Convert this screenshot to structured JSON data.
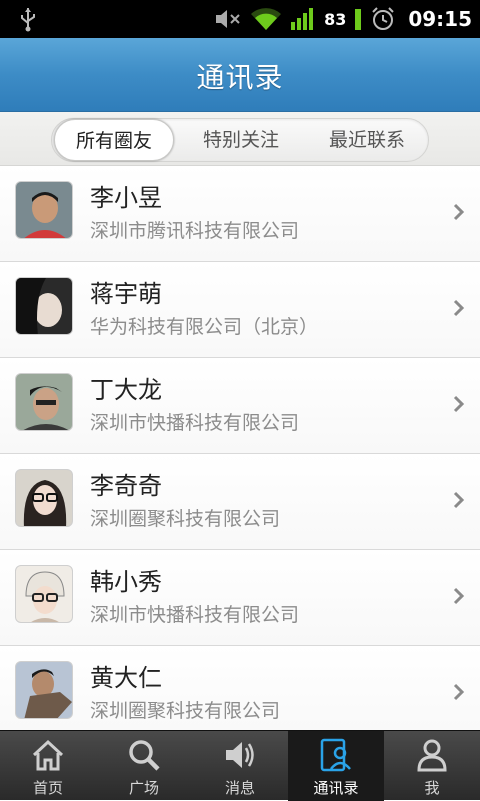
{
  "status_bar": {
    "battery": "83",
    "time": "09:15",
    "icons": [
      "usb-icon",
      "mute-icon",
      "wifi-icon",
      "signal-icon",
      "battery-icon",
      "alarm-icon"
    ]
  },
  "header": {
    "title": "通讯录"
  },
  "tabs": [
    {
      "label": "所有圈友",
      "active": true
    },
    {
      "label": "特别关注",
      "active": false
    },
    {
      "label": "最近联系",
      "active": false
    }
  ],
  "contacts": [
    {
      "name": "李小昱",
      "company": "深圳市腾讯科技有限公司"
    },
    {
      "name": "蒋宇萌",
      "company": "华为科技有限公司（北京）"
    },
    {
      "name": "丁大龙",
      "company": "深圳市快播科技有限公司"
    },
    {
      "name": "李奇奇",
      "company": "深圳圈聚科技有限公司"
    },
    {
      "name": "韩小秀",
      "company": "深圳市快播科技有限公司"
    },
    {
      "name": "黄大仁",
      "company": "深圳圈聚科技有限公司"
    }
  ],
  "bottom_nav": [
    {
      "label": "首页",
      "icon": "home-icon",
      "active": false
    },
    {
      "label": "广场",
      "icon": "search-icon",
      "active": false
    },
    {
      "label": "消息",
      "icon": "speaker-icon",
      "active": false
    },
    {
      "label": "通讯录",
      "icon": "contacts-icon",
      "active": true
    },
    {
      "label": "我",
      "icon": "person-icon",
      "active": false
    }
  ],
  "colors": {
    "header_blue": "#3d8cc6",
    "active_nav_icon": "#2aa3e8",
    "company_text": "#8c8c8c"
  }
}
